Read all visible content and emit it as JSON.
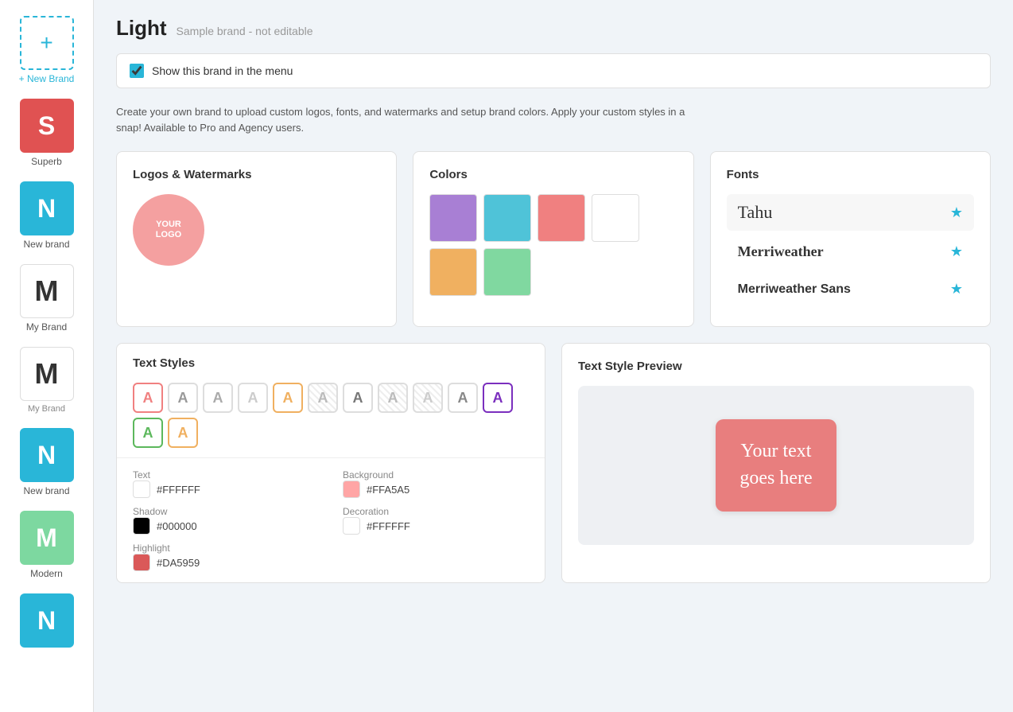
{
  "sidebar": {
    "new_brand_label": "+ New Brand",
    "plus_icon": "+",
    "items": [
      {
        "id": "superb",
        "label": "Superb",
        "letter": "S",
        "bg": "#e05252",
        "type": "letter"
      },
      {
        "id": "new-brand-1",
        "label": "New brand",
        "letter": "N",
        "bg": "#29b6d8",
        "type": "letter"
      },
      {
        "id": "my-brand-1",
        "label": "My Brand",
        "letter": "M",
        "bg": "#fff",
        "color": "#333",
        "type": "letter-light"
      },
      {
        "id": "my-brand-2",
        "label": "My Brand",
        "letter": "M",
        "bg": "#fff",
        "color": "#333",
        "type": "letter-light",
        "small_label": true
      },
      {
        "id": "new-brand-2",
        "label": "New brand",
        "letter": "N",
        "bg": "#29b6d8",
        "type": "letter"
      },
      {
        "id": "modern",
        "label": "Modern",
        "letter": "M",
        "bg": "#7dd8a0",
        "type": "letter"
      },
      {
        "id": "more",
        "label": "",
        "letter": "N",
        "bg": "#29b6d8",
        "type": "letter"
      }
    ]
  },
  "header": {
    "title": "Light",
    "subtitle": "Sample brand - not editable"
  },
  "description": "Create your own brand to upload custom logos, fonts, and watermarks and setup brand colors. Apply your custom styles in a snap! Available to Pro and Agency users.",
  "show_brand": {
    "label": "Show this brand in the menu",
    "checked": true
  },
  "logos_watermarks": {
    "title": "Logos & Watermarks",
    "logo_text": "YOUR\nLOGO"
  },
  "colors": {
    "title": "Colors",
    "swatches": [
      "#a87fd4",
      "#4fc3d8",
      "#f08080",
      "#ffffff",
      "#f0b060",
      "#80d8a0"
    ]
  },
  "fonts": {
    "title": "Fonts",
    "items": [
      {
        "name": "Tahu",
        "style": "tahu",
        "starred": true,
        "highlight": true
      },
      {
        "name": "Merriweather",
        "style": "merriweather",
        "starred": true,
        "highlight": false
      },
      {
        "name": "Merriweather Sans",
        "style": "merriweather-sans",
        "starred": true,
        "highlight": false
      }
    ]
  },
  "text_styles": {
    "title": "Text Styles",
    "badges": [
      {
        "letter": "A",
        "border_color": "#f08080",
        "color": "#f08080",
        "bg": "#fff"
      },
      {
        "letter": "A",
        "border_color": "#ddd",
        "color": "#999",
        "bg": "#fff"
      },
      {
        "letter": "A",
        "border_color": "#ddd",
        "color": "#aaa",
        "bg": "#fff"
      },
      {
        "letter": "A",
        "border_color": "#ddd",
        "color": "#ccc",
        "bg": "#fff"
      },
      {
        "letter": "A",
        "border_color": "#f0b060",
        "color": "#f0b060",
        "bg": "#fff"
      },
      {
        "letter": "A",
        "border_color": "#ddd",
        "color": "#bbb",
        "bg": "repeating-linear-gradient(45deg,#eee 0,#eee 2px,#fff 2px,#fff 6px)"
      },
      {
        "letter": "A",
        "border_color": "#ddd",
        "color": "#888",
        "bg": "#fff"
      },
      {
        "letter": "A",
        "border_color": "#ddd",
        "color": "#bbb",
        "bg": "repeating-linear-gradient(45deg,#eee 0,#eee 2px,#fff 2px,#fff 6px)"
      },
      {
        "letter": "A",
        "border_color": "#ddd",
        "color": "#ccc",
        "bg": "repeating-linear-gradient(45deg,#eee 0,#eee 2px,#fff 2px,#fff 6px)"
      },
      {
        "letter": "A",
        "border_color": "#ddd",
        "color": "#888",
        "bg": "#fff"
      },
      {
        "letter": "A",
        "border_color": "#6a0dad",
        "color": "#6a0dad",
        "bg": "#fff"
      },
      {
        "letter": "A",
        "border_color": "#5cb85c",
        "color": "#5cb85c",
        "bg": "#fff"
      },
      {
        "letter": "A",
        "border_color": "#f0b060",
        "color": "#f0b060",
        "bg": "#fff"
      }
    ]
  },
  "style_details": {
    "text_label": "Text",
    "text_value": "#FFFFFF",
    "text_color": "#ffffff",
    "bg_label": "Background",
    "bg_value": "#FFA5A5",
    "bg_color": "#ffa5a5",
    "shadow_label": "Shadow",
    "shadow_value": "#000000",
    "shadow_color": "#000000",
    "decoration_label": "Decoration",
    "decoration_value": "#FFFFFF",
    "decoration_color": "#ffffff",
    "highlight_label": "Highlight",
    "highlight_value": "#DA5959",
    "highlight_color": "#da5959"
  },
  "text_style_preview": {
    "title": "Text Style Preview",
    "preview_text": "Your text\ngoes here"
  }
}
